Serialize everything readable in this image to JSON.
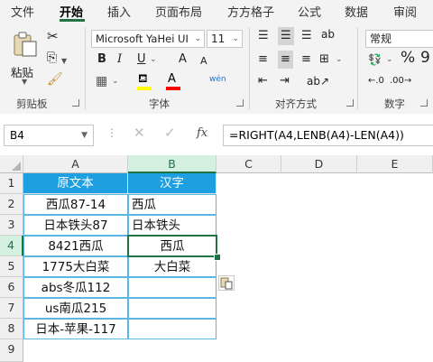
{
  "ribbon": {
    "tabs": [
      "文件",
      "开始",
      "插入",
      "页面布局",
      "方方格子",
      "公式",
      "数据",
      "审阅"
    ],
    "active_tab": "开始",
    "clipboard": {
      "paste_label": "粘贴",
      "group_label": "剪贴板"
    },
    "font": {
      "font_name": "Microsoft YaHei UI",
      "font_size": "11",
      "group_label": "字体",
      "bold": "B",
      "italic": "I",
      "underline": "U",
      "grow": "A",
      "shrink": "A",
      "phonetic": "wén"
    },
    "alignment": {
      "group_label": "对齐方式"
    },
    "number": {
      "format": "常规",
      "group_label": "数字",
      "percent": "%"
    },
    "accent_color": "#217346"
  },
  "formula_bar": {
    "name_box": "B4",
    "fx": "fx",
    "formula": "=RIGHT(A4,LENB(A4)-LEN(A4))"
  },
  "sheet": {
    "columns": [
      "A",
      "B",
      "C",
      "D",
      "E"
    ],
    "rows": [
      "1",
      "2",
      "3",
      "4",
      "5",
      "6",
      "7",
      "8",
      "9"
    ],
    "header": {
      "a": "原文本",
      "b": "汉字"
    },
    "data": [
      {
        "a": "西瓜87-14",
        "b": "西瓜"
      },
      {
        "a": "日本铁头87",
        "b": "日本铁头"
      },
      {
        "a": "8421西瓜",
        "b": "西瓜"
      },
      {
        "a": "1775大白菜",
        "b": "大白菜"
      },
      {
        "a": "abs冬瓜112",
        "b": ""
      },
      {
        "a": "us南瓜215",
        "b": ""
      },
      {
        "a": "日本-苹果-117",
        "b": ""
      }
    ],
    "header_fill": "#1ea0e0",
    "selected_cell": "B4"
  }
}
